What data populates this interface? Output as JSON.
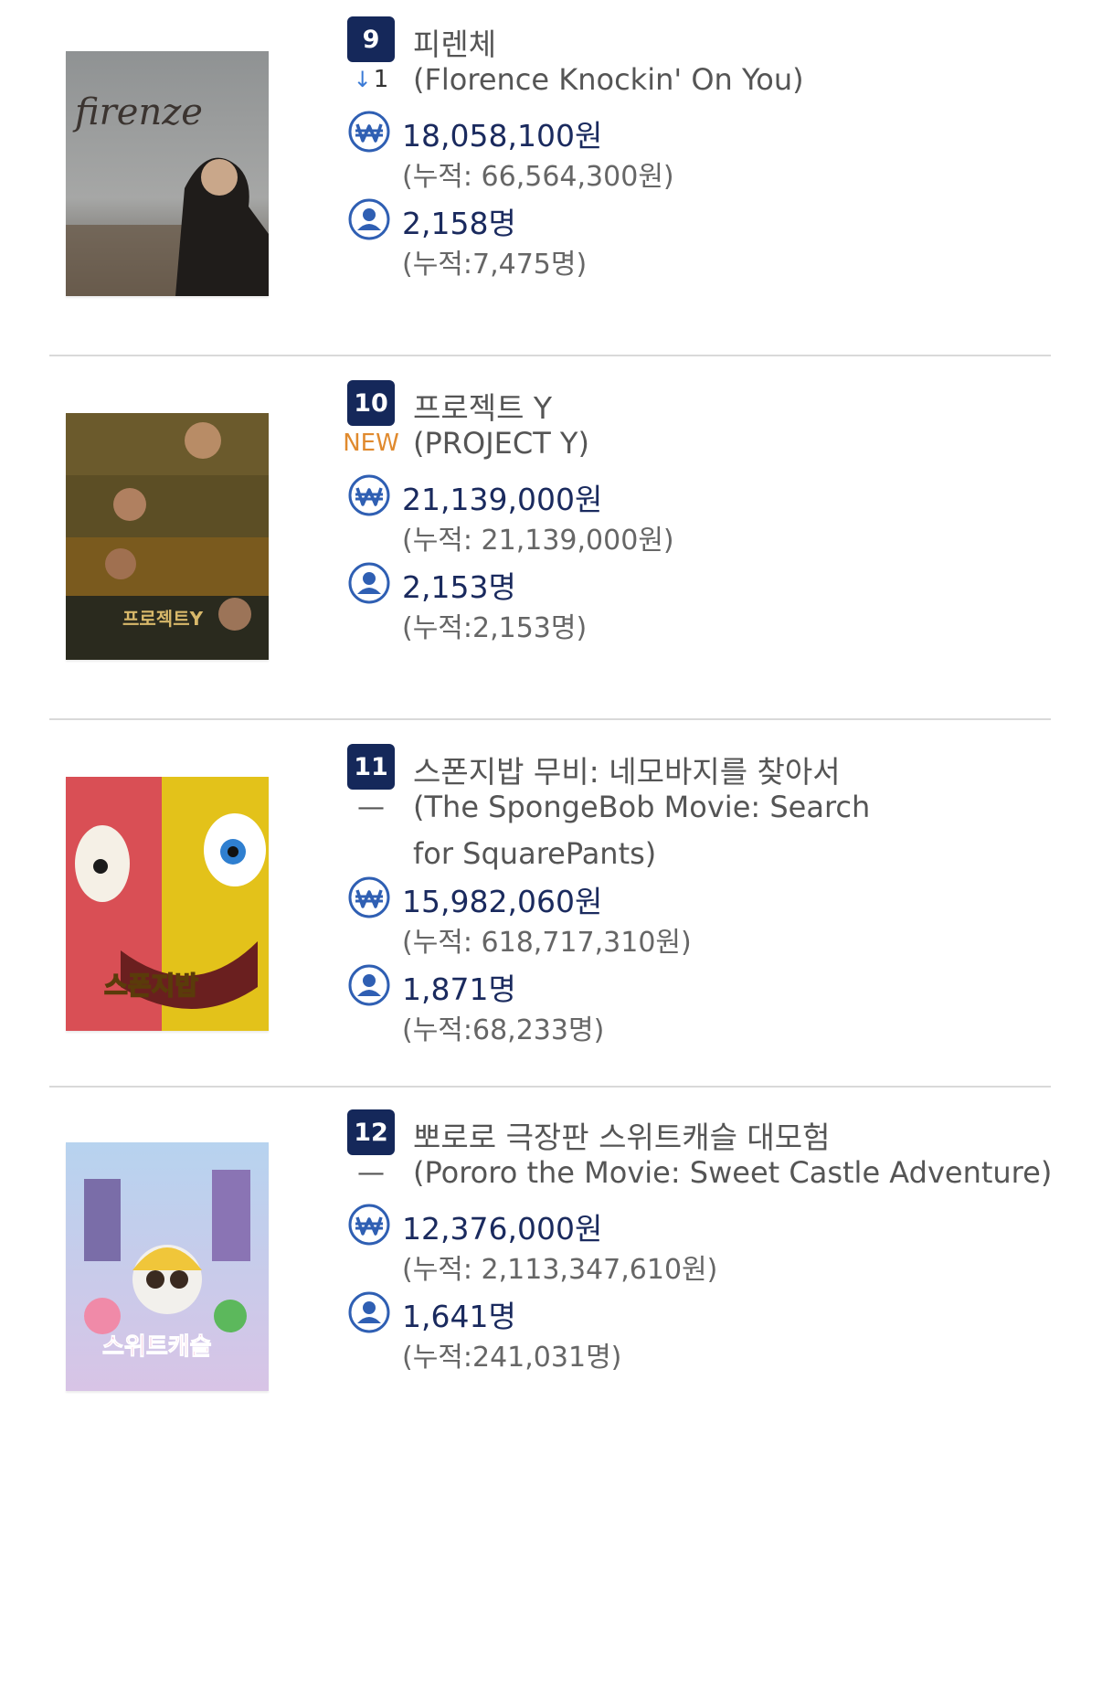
{
  "movies": [
    {
      "rank": "9",
      "change_type": "down",
      "change_arrow": "↓",
      "change_value": "1",
      "title_ko": "피렌체",
      "title_en": "(Florence Knockin' On You)",
      "revenue": "18,058,100원",
      "revenue_total": "(누적: 66,564,300원)",
      "audience": "2,158명",
      "audience_total": "(누적:7,475명)",
      "poster_text": "firenze"
    },
    {
      "rank": "10",
      "change_type": "new",
      "change_value": "NEW",
      "title_ko": "프로젝트 Y",
      "title_en": "(PROJECT Y)",
      "revenue": "21,139,000원",
      "revenue_total": "(누적: 21,139,000원)",
      "audience": "2,153명",
      "audience_total": "(누적:2,153명)",
      "poster_text": "프로젝트Y"
    },
    {
      "rank": "11",
      "change_type": "same",
      "change_value": "—",
      "title_ko": "스폰지밥 무비: 네모바지를 찾아서",
      "title_en": "(The SpongeBob Movie: Search for SquarePants)",
      "revenue": "15,982,060원",
      "revenue_total": "(누적: 618,717,310원)",
      "audience": "1,871명",
      "audience_total": "(누적:68,233명)",
      "poster_text": "스폰지밥"
    },
    {
      "rank": "12",
      "change_type": "same",
      "change_value": "—",
      "title_ko": "뽀로로 극장판 스위트캐슬 대모험",
      "title_en": "(Pororo the Movie: Sweet Castle Adventure)",
      "revenue": "12,376,000원",
      "revenue_total": "(누적: 2,113,347,610원)",
      "audience": "1,641명",
      "audience_total": "(누적:241,031명)",
      "poster_text": "스위트캐슬"
    }
  ],
  "icons": {
    "revenue": "won-icon",
    "audience": "person-icon"
  },
  "colors": {
    "rank_badge": "#15285a",
    "new_label": "#e08a2e",
    "down_arrow": "#3a7ad6",
    "stat_text": "#1a2a5e"
  }
}
